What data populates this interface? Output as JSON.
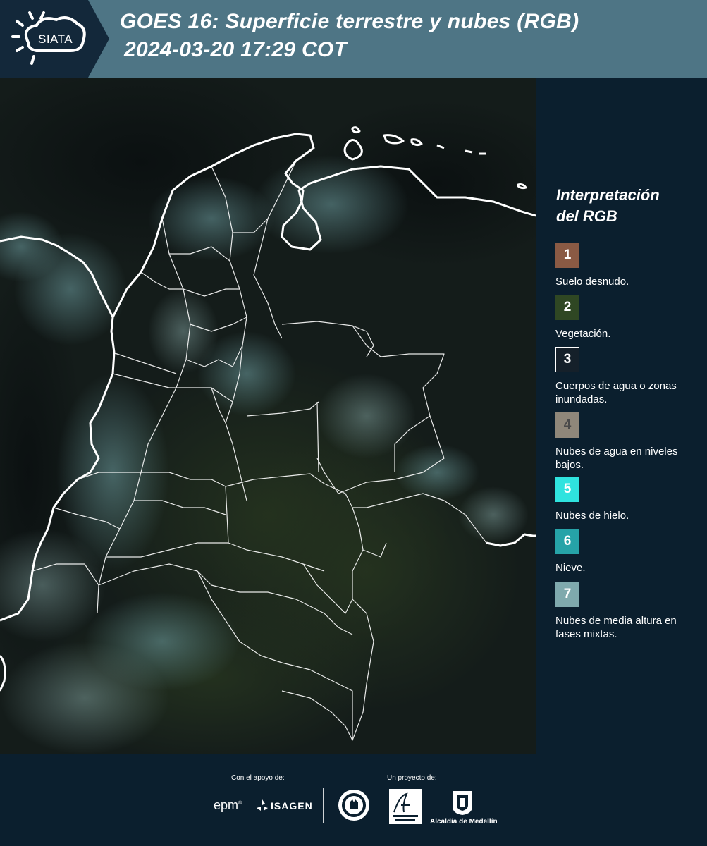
{
  "header": {
    "logo_text": "SIATA",
    "title_line1": "GOES 16: Superficie terrestre y nubes (RGB)",
    "title_line2": "2024-03-20 17:29 COT",
    "colors": {
      "header_bg": "#4e7585",
      "logo_bg": "#13283a"
    }
  },
  "map": {
    "icon": "satellite-rgb-image"
  },
  "legend": {
    "title_line1": "Interpretación",
    "title_line2": "del RGB",
    "items": [
      {
        "number": "1",
        "label": "Suelo desnudo.",
        "color": "#8a5a44"
      },
      {
        "number": "2",
        "label": "Vegetación.",
        "color": "#2f4723"
      },
      {
        "number": "3",
        "label": "Cuerpos de agua o zonas inundadas.",
        "color": "#15202a"
      },
      {
        "number": "4",
        "label": "Nubes de agua en niveles bajos.",
        "color": "#8f877a"
      },
      {
        "number": "5",
        "label": "Nubes de hielo.",
        "color": "#2fe3df"
      },
      {
        "number": "6",
        "label": "Nieve.",
        "color": "#26a3a8"
      },
      {
        "number": "7",
        "label": "Nubes de media altura en fases mixtas.",
        "color": "#7fa9ad"
      }
    ]
  },
  "footer": {
    "support_caption": "Con el apoyo de:",
    "project_caption": "Un proyecto de:",
    "epm": "epm",
    "isagen": "ISAGEN",
    "alcaldia": "Alcaldía de Medellín"
  }
}
